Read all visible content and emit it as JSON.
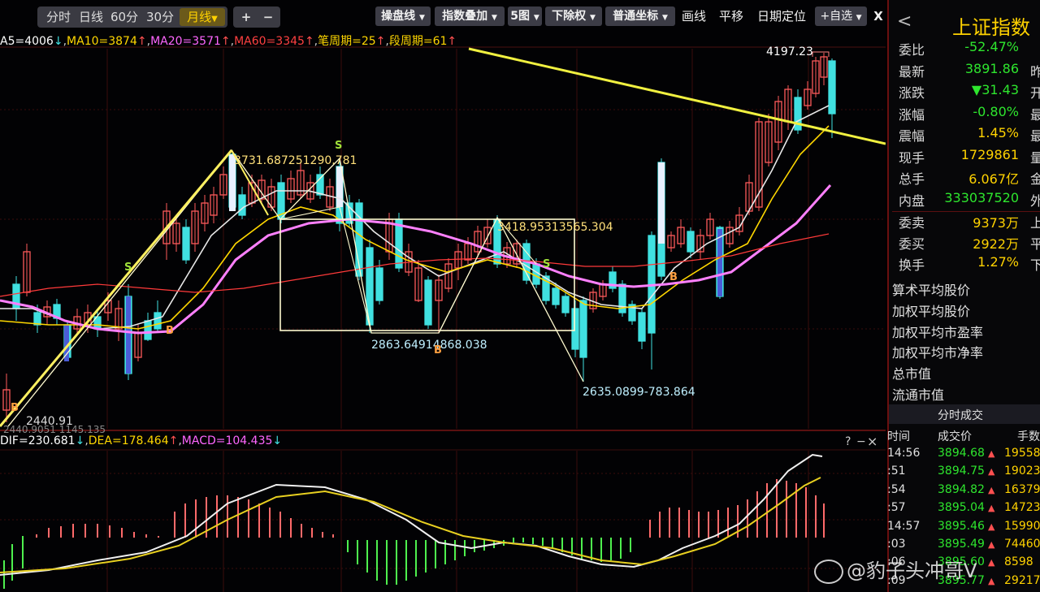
{
  "toolbar": {
    "period_tabs": [
      "分时",
      "日线",
      "60分",
      "30分",
      "月线"
    ],
    "active_tab": "月线",
    "zoom_in": "+",
    "zoom_out": "−",
    "buttons": [
      "操盘线",
      "指数叠加",
      "5图",
      "下除权",
      "普通坐标"
    ],
    "plain": [
      "画线",
      "平移",
      "日期定位"
    ],
    "favorite": "+自选",
    "close": "X"
  },
  "ma_legend": {
    "ma5": "A5=4006",
    "ma10": "MA10=3874",
    "ma20": "MA20=3571",
    "ma60": "MA60=3345",
    "bi": "笔周期=25",
    "duan": "段周期=61"
  },
  "macd_legend": {
    "dif": "DIF=230.681",
    "dea": "DEA=178.464",
    "macd": "MACD=104.435",
    "help": "?",
    "minus": "−",
    "close": "×"
  },
  "annotations": {
    "high_4197": "4197.23",
    "peak_3731": "3731.68725",
    "peak_1290": "1290.781",
    "peak_3418": "3418.95313",
    "peak_565": "565.304",
    "low_2863": "2863.64914",
    "low_868": "868.038",
    "low_2635": "2635.0899-783.864",
    "low_2440": "2440.91",
    "low_2440b": "2440.9051",
    "low_2440c": "1145.135",
    "sig_s1": "S",
    "sig_s2": "S",
    "sig_b1": "B",
    "sig_b2": "B",
    "sig_b3": "B",
    "sig_b4": "B",
    "sig_s3": "S"
  },
  "panel": {
    "back": "<",
    "title": "上证指数",
    "rows": [
      {
        "key": "委比",
        "val": "-52.47%",
        "color": "#2ee62e",
        "tail": ""
      },
      {
        "key": "最新",
        "val": "3891.86",
        "color": "#2ee62e",
        "tail": "昨"
      },
      {
        "key": "涨跌",
        "val": "▼31.43",
        "color": "#2ee62e",
        "tail": "开"
      },
      {
        "key": "涨幅",
        "val": "-0.80%",
        "color": "#2ee62e",
        "tail": "最"
      },
      {
        "key": "震幅",
        "val": "1.45%",
        "color": "#ffd200",
        "tail": "最"
      },
      {
        "key": "现手",
        "val": "1729861",
        "color": "#ffd200",
        "tail": "量"
      },
      {
        "key": "总手",
        "val": "6.067亿",
        "color": "#ffd200",
        "tail": "金"
      },
      {
        "key": "内盘",
        "val": "333037520",
        "color": "#2ee62e",
        "tail": "外"
      },
      {
        "key": "委卖",
        "val": "9373万",
        "color": "#ffd200",
        "tail": "上"
      },
      {
        "key": "委买",
        "val": "2922万",
        "color": "#ffd200",
        "tail": "平"
      },
      {
        "key": "换手",
        "val": "1.27%",
        "color": "#ffd200",
        "tail": "下"
      }
    ],
    "menu": [
      "算术平均股价",
      "加权平均股价",
      "加权平均市盈率",
      "加权平均市净率",
      "总市值",
      "流通市值"
    ],
    "ticks_title": "分时成交",
    "ticks_headers": [
      "时间",
      "成交价",
      "手数"
    ],
    "ticks": [
      {
        "time": "14:56",
        "price": "3894.68",
        "arrow": "▲",
        "vol": "19558"
      },
      {
        "time": ":51",
        "price": "3894.75",
        "arrow": "▲",
        "vol": "19023"
      },
      {
        "time": ":54",
        "price": "3894.82",
        "arrow": "▲",
        "vol": "16379"
      },
      {
        "time": ":57",
        "price": "3895.04",
        "arrow": "▲",
        "vol": "14723"
      },
      {
        "time": "14:57",
        "price": "3895.46",
        "arrow": "▲",
        "vol": "15990"
      },
      {
        "time": ":03",
        "price": "3895.49",
        "arrow": "▲",
        "vol": "74460"
      },
      {
        "time": ":06",
        "price": "3895.60",
        "arrow": "▲",
        "vol": "8598"
      },
      {
        "time": ":09",
        "price": "3895.77",
        "arrow": "▲",
        "vol": "29217"
      }
    ]
  },
  "watermark": "@豹子头冲哥V",
  "colors": {
    "up": "#ff5a5a",
    "down": "#40e0e0",
    "ma5": "#ffffff",
    "ma10": "#ffd700",
    "ma20": "#ff66ff",
    "ma60": "#ff4040",
    "trend": "#f0f040"
  }
}
